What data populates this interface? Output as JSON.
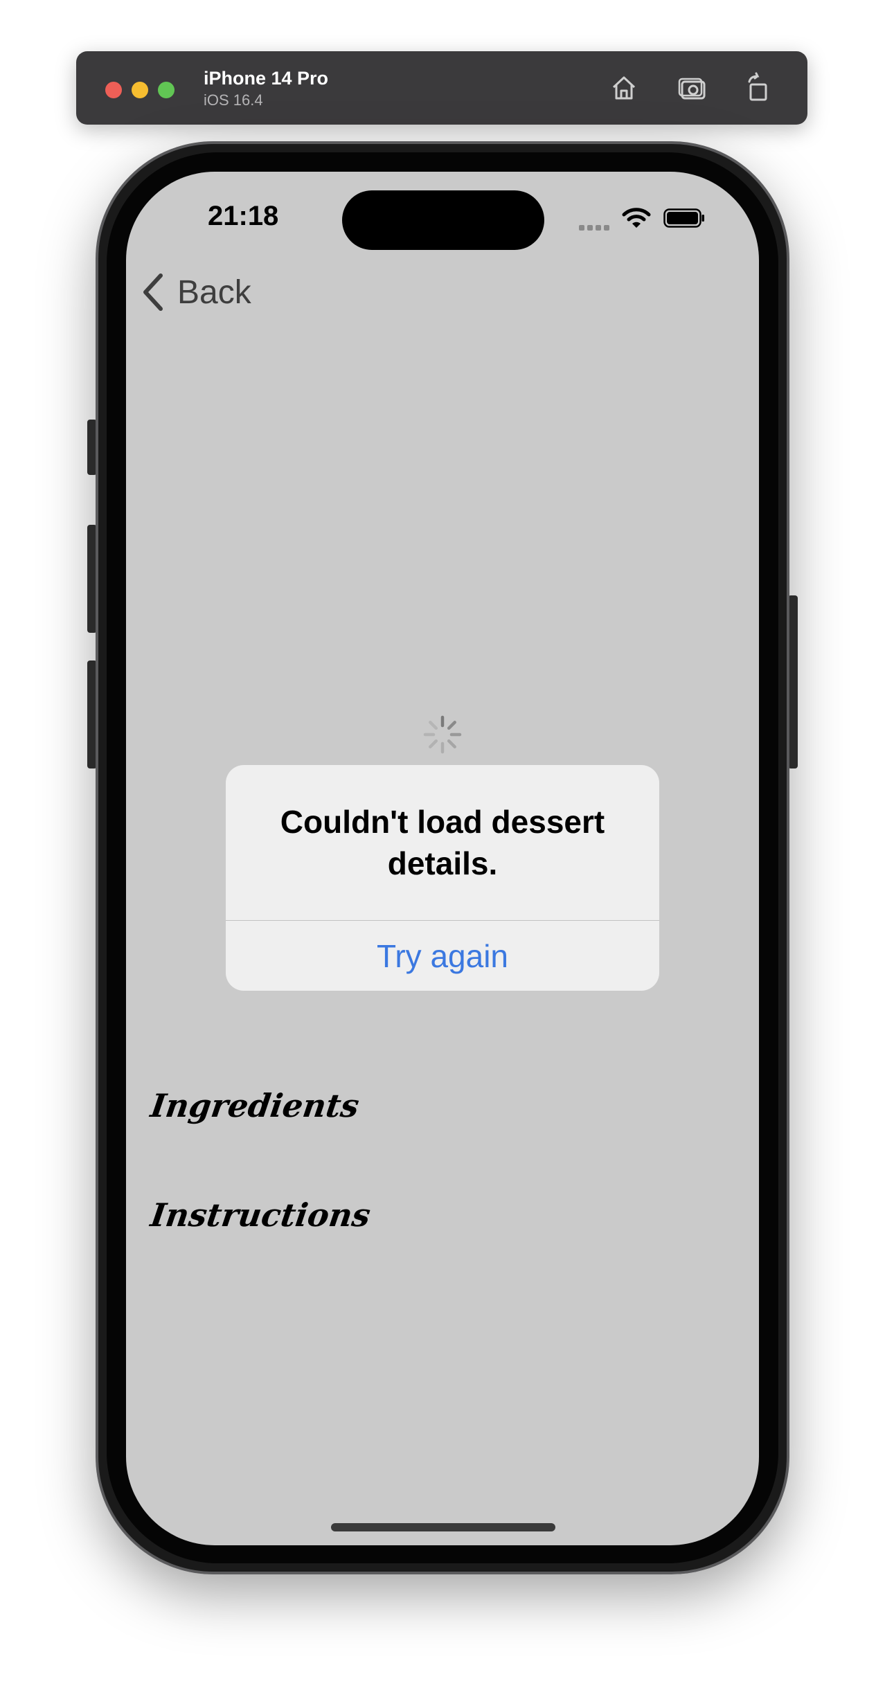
{
  "simulator": {
    "device_name": "iPhone 14 Pro",
    "os_version": "iOS 16.4",
    "buttons": [
      "home-icon",
      "screenshot-icon",
      "rotate-icon"
    ]
  },
  "status_bar": {
    "time": "21:18"
  },
  "nav": {
    "back_label": "Back"
  },
  "alert": {
    "title": "Couldn't load dessert details.",
    "action_label": "Try again",
    "action_color": "#3b78e0"
  },
  "sections": {
    "ingredients": "Ingredients",
    "instructions": "Instructions"
  },
  "colors": {
    "screen_background": "#cacaca",
    "alert_background": "#efefef"
  }
}
